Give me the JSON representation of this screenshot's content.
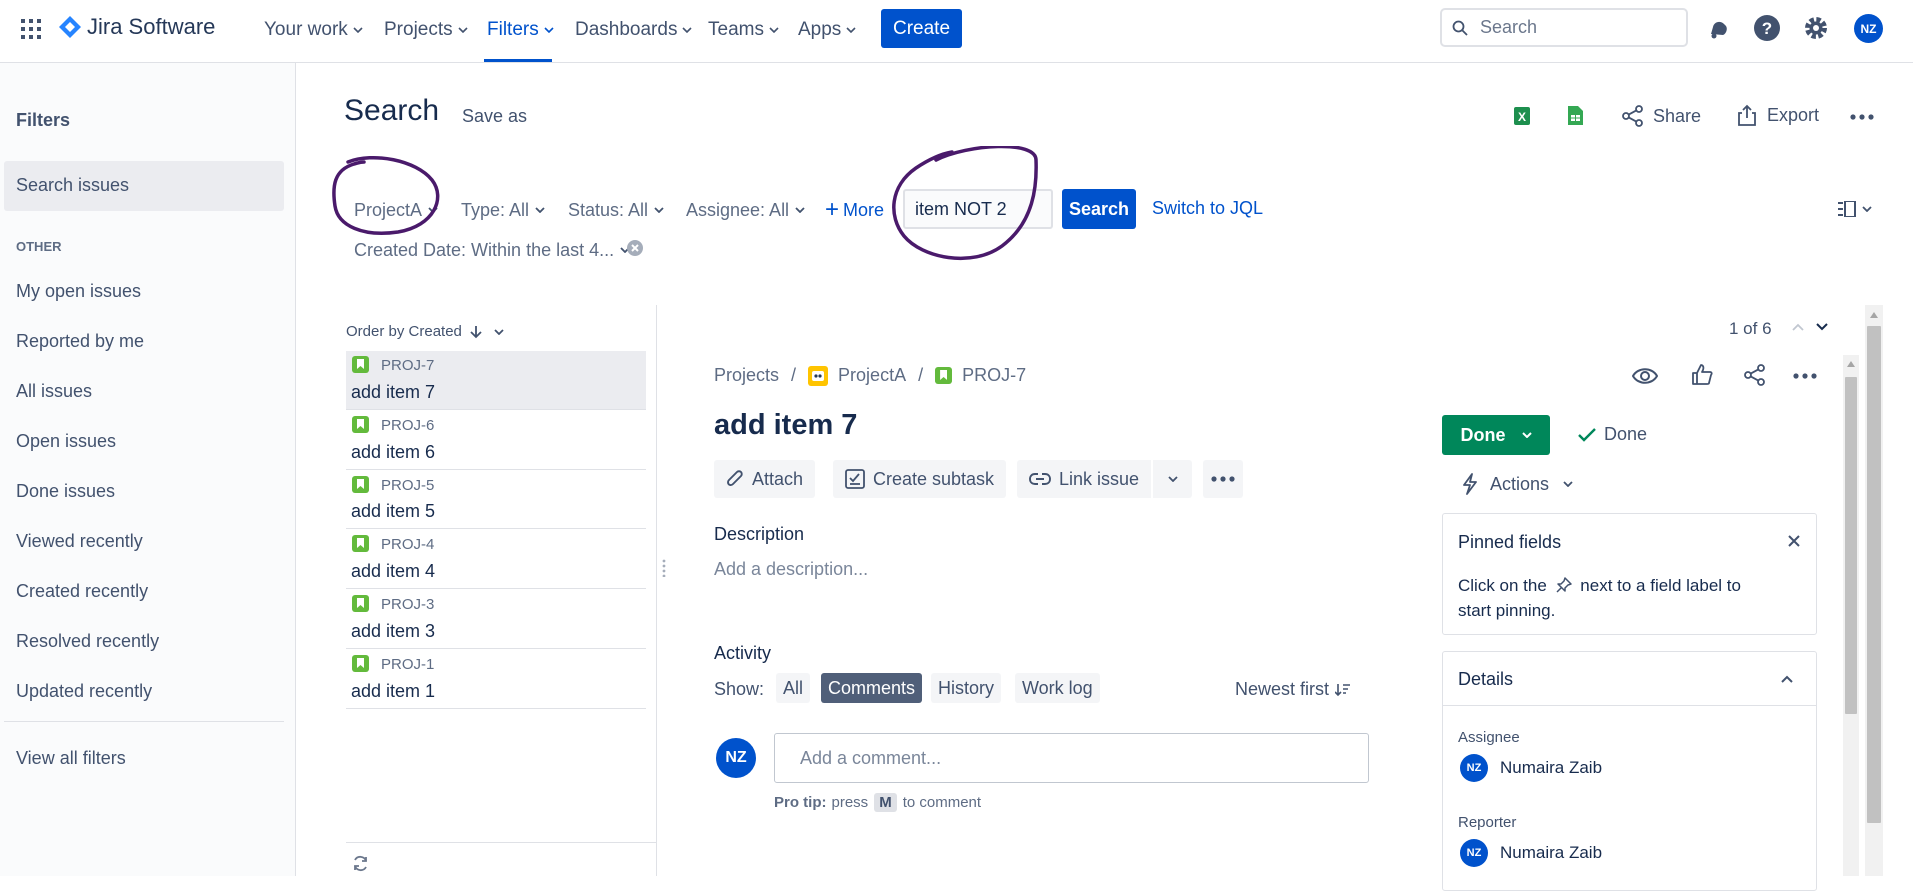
{
  "topnav": {
    "app_name": "Jira Software",
    "items": [
      {
        "label": "Your work"
      },
      {
        "label": "Projects"
      },
      {
        "label": "Filters"
      },
      {
        "label": "Dashboards"
      },
      {
        "label": "Teams"
      },
      {
        "label": "Apps"
      }
    ],
    "create_label": "Create",
    "search_placeholder": "Search",
    "user_initials": "NZ"
  },
  "sidebar": {
    "title": "Filters",
    "selected_item": "Search issues",
    "section_other": "OTHER",
    "items": [
      "My open issues",
      "Reported by me",
      "All issues",
      "Open issues",
      "Done issues",
      "Viewed recently",
      "Created recently",
      "Resolved recently",
      "Updated recently"
    ],
    "view_all": "View all filters"
  },
  "header": {
    "title": "Search",
    "save_as": "Save as",
    "share": "Share",
    "export": "Export"
  },
  "filters": {
    "project": "ProjectA",
    "type": "Type: All",
    "status": "Status: All",
    "assignee": "Assignee: All",
    "more": "More",
    "query": "item NOT 2",
    "search_button": "Search",
    "switch_jql": "Switch to JQL",
    "created_date": "Created Date: Within the last 4..."
  },
  "issue_list": {
    "order_by": "Order by Created",
    "issues": [
      {
        "key": "PROJ-7",
        "title": "add item 7"
      },
      {
        "key": "PROJ-6",
        "title": "add item 6"
      },
      {
        "key": "PROJ-5",
        "title": "add item 5"
      },
      {
        "key": "PROJ-4",
        "title": "add item 4"
      },
      {
        "key": "PROJ-3",
        "title": "add item 3"
      },
      {
        "key": "PROJ-1",
        "title": "add item 1"
      }
    ]
  },
  "issue": {
    "pagination": "1 of 6",
    "breadcrumb_projects": "Projects",
    "breadcrumb_project": "ProjectA",
    "breadcrumb_key": "PROJ-7",
    "title": "add item 7",
    "attach": "Attach",
    "create_subtask": "Create subtask",
    "link_issue": "Link issue",
    "description_label": "Description",
    "description_placeholder": "Add a description...",
    "activity_label": "Activity",
    "show_label": "Show:",
    "tabs": [
      "All",
      "Comments",
      "History",
      "Work log"
    ],
    "newest_first": "Newest first",
    "comment_placeholder": "Add a comment...",
    "pro_tip_bold": "Pro tip:",
    "pro_tip_press": "press",
    "pro_tip_key": "M",
    "pro_tip_rest": "to comment",
    "user_initials": "NZ",
    "status_button": "Done",
    "resolution": "Done",
    "actions": "Actions",
    "pinned_title": "Pinned fields",
    "pinned_text_1": "Click on the",
    "pinned_text_2": "next to a field label to start pinning.",
    "details_title": "Details",
    "assignee_label": "Assignee",
    "assignee_name": "Numaira Zaib",
    "reporter_label": "Reporter",
    "reporter_name": "Numaira Zaib"
  },
  "colors": {
    "brand_blue": "#0052cc",
    "done_green": "#00875a",
    "story_green": "#63ba3c",
    "annotation_purple": "#4a1a6b"
  }
}
